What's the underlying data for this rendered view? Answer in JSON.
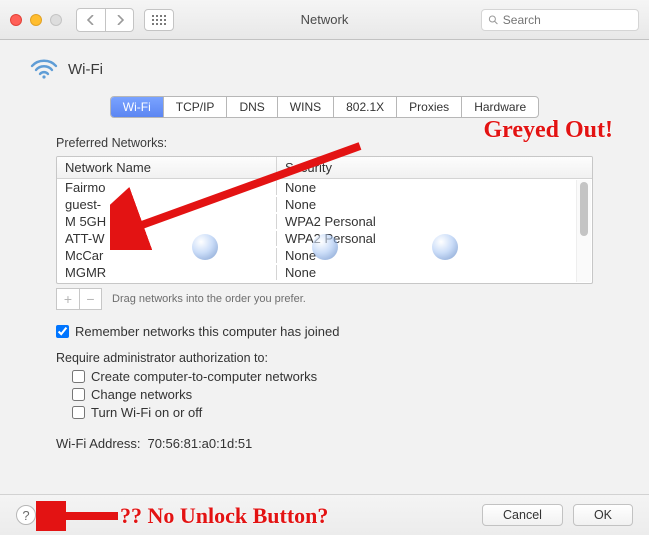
{
  "window": {
    "title": "Network",
    "searchPlaceholder": "Search"
  },
  "header": {
    "title": "Wi-Fi"
  },
  "tabs": [
    "Wi-Fi",
    "TCP/IP",
    "DNS",
    "WINS",
    "802.1X",
    "Proxies",
    "Hardware"
  ],
  "activeTab": 0,
  "preferred": {
    "label": "Preferred Networks:",
    "columns": {
      "name": "Network Name",
      "security": "Security"
    },
    "rows": [
      {
        "name": "Fairmo",
        "security": "None"
      },
      {
        "name": "guest-",
        "security": "None"
      },
      {
        "name": "M 5GH",
        "security": "WPA2 Personal"
      },
      {
        "name": "ATT-W",
        "security": "WPA2 Personal"
      },
      {
        "name": "McCar",
        "security": "None"
      },
      {
        "name": "MGMR",
        "security": "None"
      }
    ],
    "dragHint": "Drag networks into the order you prefer."
  },
  "remember": {
    "checked": true,
    "label": "Remember networks this computer has joined"
  },
  "adminAuth": {
    "label": "Require administrator authorization to:",
    "items": [
      {
        "checked": false,
        "label": "Create computer-to-computer networks"
      },
      {
        "checked": false,
        "label": "Change networks"
      },
      {
        "checked": false,
        "label": "Turn Wi-Fi on or off"
      }
    ]
  },
  "wifiAddress": {
    "label": "Wi-Fi Address:",
    "value": "70:56:81:a0:1d:51"
  },
  "footer": {
    "cancel": "Cancel",
    "ok": "OK"
  },
  "annotations": {
    "greyed": "Greyed Out!",
    "unlock": "?? No Unlock Button?"
  }
}
